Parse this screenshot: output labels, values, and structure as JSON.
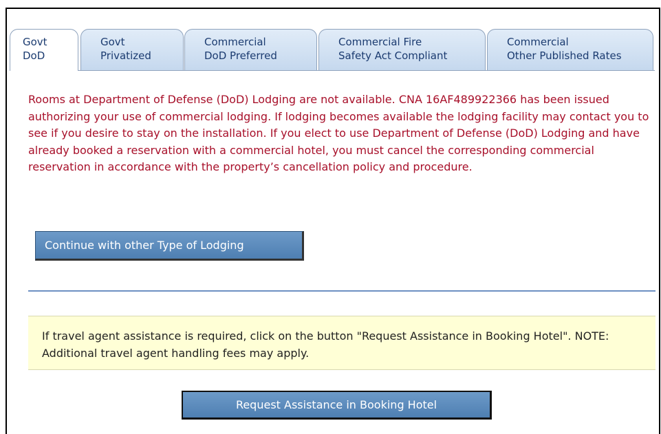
{
  "tabs": [
    {
      "line1": "Govt",
      "line2": "DoD",
      "active": true
    },
    {
      "line1": "Govt",
      "line2": "Privatized",
      "active": false
    },
    {
      "line1": "Commercial",
      "line2": "DoD Preferred",
      "active": false
    },
    {
      "line1": "Commercial Fire",
      "line2": "Safety Act Compliant",
      "active": false
    },
    {
      "line1": "Commercial",
      "line2": "Other Published Rates",
      "active": false
    }
  ],
  "notice": {
    "text": "Rooms at Department of Defense (DoD) Lodging are not available. CNA 16AF489922366 has been issued authorizing your use of commercial lodging. If lodging becomes available the lodging facility may contact you to see if you desire to stay on the installation. If you elect to use Department of Defense (DoD) Lodging and have already booked a reservation with a commercial hotel, you must cancel the corresponding commercial reservation in accordance with the property’s cancellation policy and procedure."
  },
  "actions": {
    "continue_label": "Continue with other Type of Lodging",
    "assist_label": "Request Assistance in Booking Hotel"
  },
  "assist_notice": {
    "text": "If travel agent assistance is required, click on the button \"Request Assistance in Booking Hotel\". NOTE: Additional travel agent handling fees may apply."
  },
  "colors": {
    "notice_text": "#a8102a",
    "button_bg": "#5b8bbd",
    "tab_bg": "#d3e2f4",
    "assist_bg": "#ffffd6"
  }
}
